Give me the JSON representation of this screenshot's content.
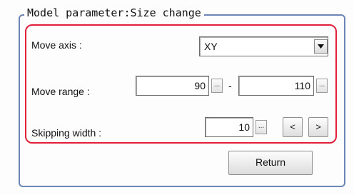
{
  "group": {
    "title": "Model parameter:Size change"
  },
  "move_axis": {
    "label": "Move axis :",
    "value": "XY"
  },
  "move_range": {
    "label": "Move range :",
    "min": "90",
    "separator": "-",
    "max": "110",
    "ellipsis": "..."
  },
  "skipping_width": {
    "label": "Skipping width :",
    "value": "10",
    "ellipsis": "...",
    "prev": "<",
    "next": ">"
  },
  "buttons": {
    "return": "Return"
  },
  "colors": {
    "group_border": "#6b86b6",
    "highlight_border": "#e0203a"
  }
}
